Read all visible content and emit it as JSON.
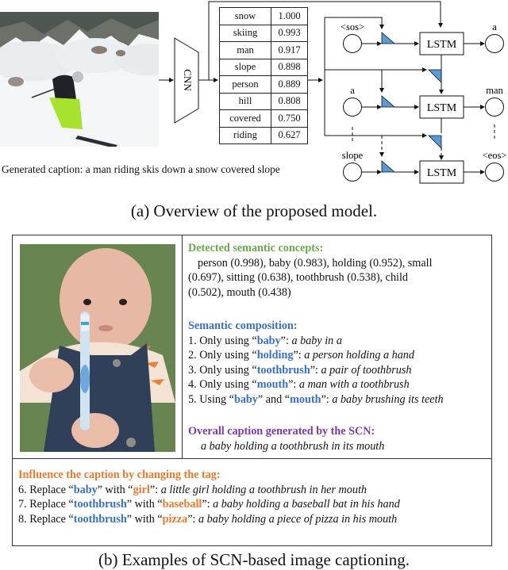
{
  "part_a": {
    "cnn_label": "CNN",
    "concepts": [
      {
        "word": "snow",
        "score": "1.000"
      },
      {
        "word": "skiing",
        "score": "0.993"
      },
      {
        "word": "man",
        "score": "0.917"
      },
      {
        "word": "slope",
        "score": "0.898"
      },
      {
        "word": "person",
        "score": "0.889"
      },
      {
        "word": "hill",
        "score": "0.808"
      },
      {
        "word": "covered",
        "score": "0.750"
      },
      {
        "word": "riding",
        "score": "0.627"
      }
    ],
    "lstm_rows": [
      {
        "input": "<sos>",
        "cell": "LSTM",
        "output": "a"
      },
      {
        "input": "a",
        "cell": "LSTM",
        "output": "man"
      },
      {
        "input": "slope",
        "cell": "LSTM",
        "output": "<eos>"
      }
    ],
    "generated_caption": "Generated caption: a man riding skis down a snow covered slope",
    "figure_caption": "(a) Overview of the proposed model."
  },
  "part_b": {
    "detected": {
      "heading": "Detected semantic concepts:",
      "lines": [
        "person (0.998), baby (0.983), holding (0.952), small",
        "(0.697), sitting (0.638), toothbrush (0.538), child",
        "(0.502), mouth (0.438)"
      ]
    },
    "composition": {
      "heading": "Semantic composition:",
      "items": [
        {
          "prefix": "1. Only using “",
          "tag": "baby",
          "mid": "”:  ",
          "result": "a baby in a"
        },
        {
          "prefix": "2. Only using “",
          "tag": "holding",
          "mid": "”: ",
          "result": "a person holding a hand"
        },
        {
          "prefix": "3. Only using “",
          "tag": "toothbrush",
          "mid": "”: ",
          "result": "a pair of toothbrush"
        },
        {
          "prefix": "4. Only using “",
          "tag": "mouth",
          "mid": "”: ",
          "result": "a man with a toothbrush"
        },
        {
          "prefix": "5. Using “",
          "tag": "baby",
          "mid": "” and “",
          "tag2": "mouth",
          "mid2": "”: ",
          "result": "a baby brushing its teeth"
        }
      ]
    },
    "overall": {
      "heading": "Overall caption generated by the SCN:",
      "caption": "a baby holding a toothbrush in its mouth"
    },
    "influence": {
      "heading": "Influence the caption by changing the tag:",
      "items": [
        {
          "prefix": "6. Replace “",
          "from": "baby",
          "with": "” with “",
          "to": "girl",
          "mid": "”: ",
          "result": "a little girl holding a toothbrush in her mouth"
        },
        {
          "prefix": "7. Replace “",
          "from": "toothbrush",
          "with": "” with “",
          "to": "baseball",
          "mid": "”: ",
          "result": "a baby holding a baseball bat in his hand"
        },
        {
          "prefix": "8. Replace “",
          "from": "toothbrush",
          "with": "” with “",
          "to": "pizza",
          "mid": "”: ",
          "result": "a baby holding a piece of pizza in his mouth"
        }
      ]
    },
    "figure_caption": "(b) Examples of SCN-based image captioning."
  },
  "colors": {
    "detected": "#6aa84f",
    "composition": "#3a6fc9",
    "overall": "#7a3aa8",
    "influence": "#ea7a2e",
    "gate_fill": "#5b9bd5"
  }
}
